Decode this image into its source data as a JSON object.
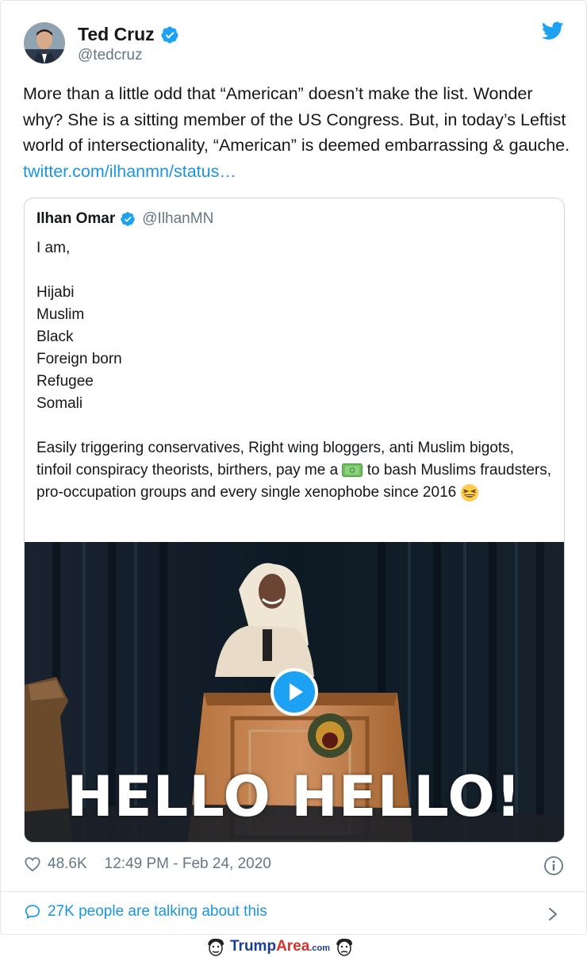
{
  "author": {
    "name": "Ted Cruz",
    "handle": "@tedcruz"
  },
  "tweet": {
    "text": "More than a little odd that “American” doesn’t make the list. Wonder why?  She is a sitting member of the US Congress. But, in today’s Leftist world of intersectionality, “American” is deemed embarrassing & gauche. ",
    "link": "twitter.com/ilhanmn/status…"
  },
  "quoted": {
    "name": "Ilhan Omar",
    "handle": "@IlhanMN",
    "intro": "I am,",
    "list": "Hijabi\nMuslim\nBlack\nForeign born\nRefugee\nSomali",
    "para_before_emoji": "Easily triggering conservatives, Right wing bloggers, anti Muslim bigots, tinfoil conspiracy theorists, birthers, pay me a ",
    "para_middle": " to bash Muslims fraudsters, pro-occupation groups  and every single xenophobe since 2016 ",
    "money_emoji": "money-emoji",
    "laugh_emoji": "grinning-squinting-emoji",
    "media_caption": "HELLO HELLO!"
  },
  "stats": {
    "likes": "48.6K",
    "timestamp": "12:49 PM - Feb 24, 2020"
  },
  "talking": {
    "label": "27K people are talking about this"
  },
  "watermark": {
    "brand_main": "Trump",
    "brand_accent": "Area",
    "brand_tld": ".com"
  },
  "colors": {
    "link": "#1b95e0",
    "verified": "#1da1f2",
    "muted": "#657786"
  }
}
